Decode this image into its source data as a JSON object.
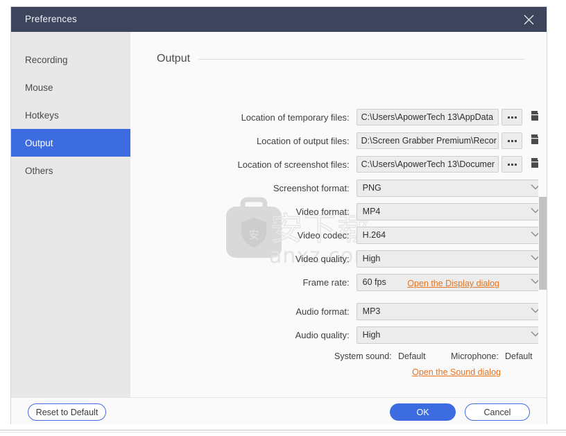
{
  "window": {
    "title": "Preferences",
    "close_icon": "close-icon"
  },
  "sidebar": {
    "items": [
      {
        "label": "Recording",
        "active": false
      },
      {
        "label": "Mouse",
        "active": false
      },
      {
        "label": "Hotkeys",
        "active": false
      },
      {
        "label": "Output",
        "active": true
      },
      {
        "label": "Others",
        "active": false
      }
    ]
  },
  "content": {
    "section_title": "Output",
    "path_rows": [
      {
        "label": "Location of temporary files:",
        "value": "C:\\Users\\ApowerTech 13\\AppData",
        "browse_label": "...",
        "folder_icon": "folder-icon"
      },
      {
        "label": "Location of output files:",
        "value": "D:\\Screen Grabber Premium\\Recor",
        "browse_label": "...",
        "folder_icon": "folder-icon"
      },
      {
        "label": "Location of screenshot files:",
        "value": "C:\\Users\\ApowerTech 13\\Documer",
        "browse_label": "...",
        "folder_icon": "folder-icon"
      }
    ],
    "select_rows": [
      {
        "name": "screenshot-format",
        "label": "Screenshot format:",
        "value": "PNG"
      },
      {
        "name": "video-format",
        "label": "Video format:",
        "value": "MP4"
      },
      {
        "name": "video-codec",
        "label": "Video codec:",
        "value": "H.264"
      },
      {
        "name": "video-quality",
        "label": "Video quality:",
        "value": "High"
      },
      {
        "name": "frame-rate",
        "label": "Frame rate:",
        "value": "60 fps"
      }
    ],
    "display_link": "Open the Display dialog",
    "audio_rows": [
      {
        "name": "audio-format",
        "label": "Audio format:",
        "value": "MP3"
      },
      {
        "name": "audio-quality",
        "label": "Audio quality:",
        "value": "High"
      }
    ],
    "system_sound_label": "System sound:",
    "system_sound_value": "Default",
    "microphone_label": "Microphone:",
    "microphone_value": "Default",
    "sound_link": "Open the Sound dialog"
  },
  "footer": {
    "reset_label": "Reset to Default",
    "ok_label": "OK",
    "cancel_label": "Cancel"
  },
  "watermark": {
    "site": "anxz.com",
    "cjk": "安下载"
  },
  "colors": {
    "titlebar": "#3c455c",
    "accent": "#3d6ce0",
    "link": "#e8721e",
    "sidebar": "#e8e8e8",
    "field": "#ececec"
  }
}
